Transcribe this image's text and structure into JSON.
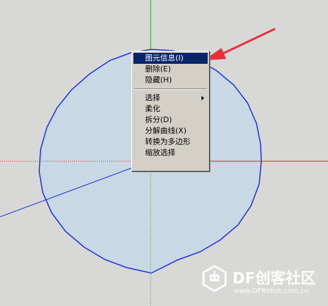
{
  "context_menu": {
    "items": [
      {
        "label": "图元信息(I)"
      },
      {
        "label": "删除(E)"
      },
      {
        "label": "隐藏(H)"
      },
      {
        "label": "选择"
      },
      {
        "label": "柔化"
      },
      {
        "label": "拆分(D)"
      },
      {
        "label": "分解曲线(X)"
      },
      {
        "label": "转换为多边形"
      },
      {
        "label": "缩放选择"
      }
    ]
  },
  "watermark": {
    "title": "DF创客社区",
    "url": "www.DFRobot.com.cn"
  },
  "colors": {
    "background": "#d8d8d6",
    "circle_fill": "#c8d8e4",
    "circle_stroke": "#1a2fd6",
    "axis_green": "#2aa02a",
    "axis_red": "#e02020",
    "annotation_arrow": "#e8303a",
    "menu_highlight": "#0a246a"
  }
}
